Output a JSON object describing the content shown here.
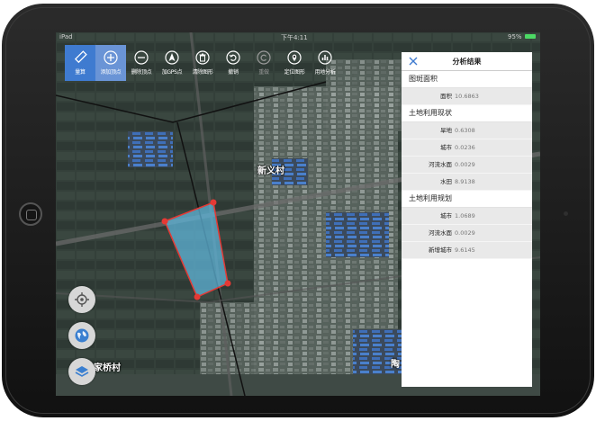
{
  "status_bar": {
    "carrier": "iPad",
    "time": "下午4:11",
    "battery": "95%"
  },
  "toolbar": {
    "items": [
      {
        "label": "量算",
        "icon": "ruler-icon"
      },
      {
        "label": "添加顶点",
        "icon": "plus-circle-icon"
      },
      {
        "label": "删除顶点",
        "icon": "minus-circle-icon"
      },
      {
        "label": "加GPS点",
        "icon": "gps-point-icon"
      },
      {
        "label": "清除图形",
        "icon": "trash-icon"
      },
      {
        "label": "撤销",
        "icon": "undo-icon"
      },
      {
        "label": "重做",
        "icon": "redo-icon"
      },
      {
        "label": "定位图形",
        "icon": "locate-pin-icon"
      },
      {
        "label": "用地分析",
        "icon": "bar-chart-icon"
      }
    ]
  },
  "panel": {
    "title": "分析结果",
    "sections": [
      {
        "title": "图斑面积",
        "rows": [
          {
            "k": "面积",
            "v": "10.6863"
          }
        ]
      },
      {
        "title": "土地利用现状",
        "rows": [
          {
            "k": "旱地",
            "v": "0.6308"
          },
          {
            "k": "城市",
            "v": "0.0236"
          },
          {
            "k": "河流水面",
            "v": "0.0029"
          },
          {
            "k": "水田",
            "v": "8.9138"
          }
        ]
      },
      {
        "title": "土地利用规划",
        "rows": [
          {
            "k": "城市",
            "v": "1.0689"
          },
          {
            "k": "河流水面",
            "v": "0.0029"
          },
          {
            "k": "新增城市",
            "v": "9.6145"
          }
        ]
      }
    ]
  },
  "map": {
    "labels": {
      "village_1": "新义村",
      "village_2": "家桥村",
      "partial": "陶"
    }
  },
  "colors": {
    "accent": "#3f7bd0",
    "polygon_edge": "#e53935",
    "polygon_fill": "#5fb4d8"
  }
}
